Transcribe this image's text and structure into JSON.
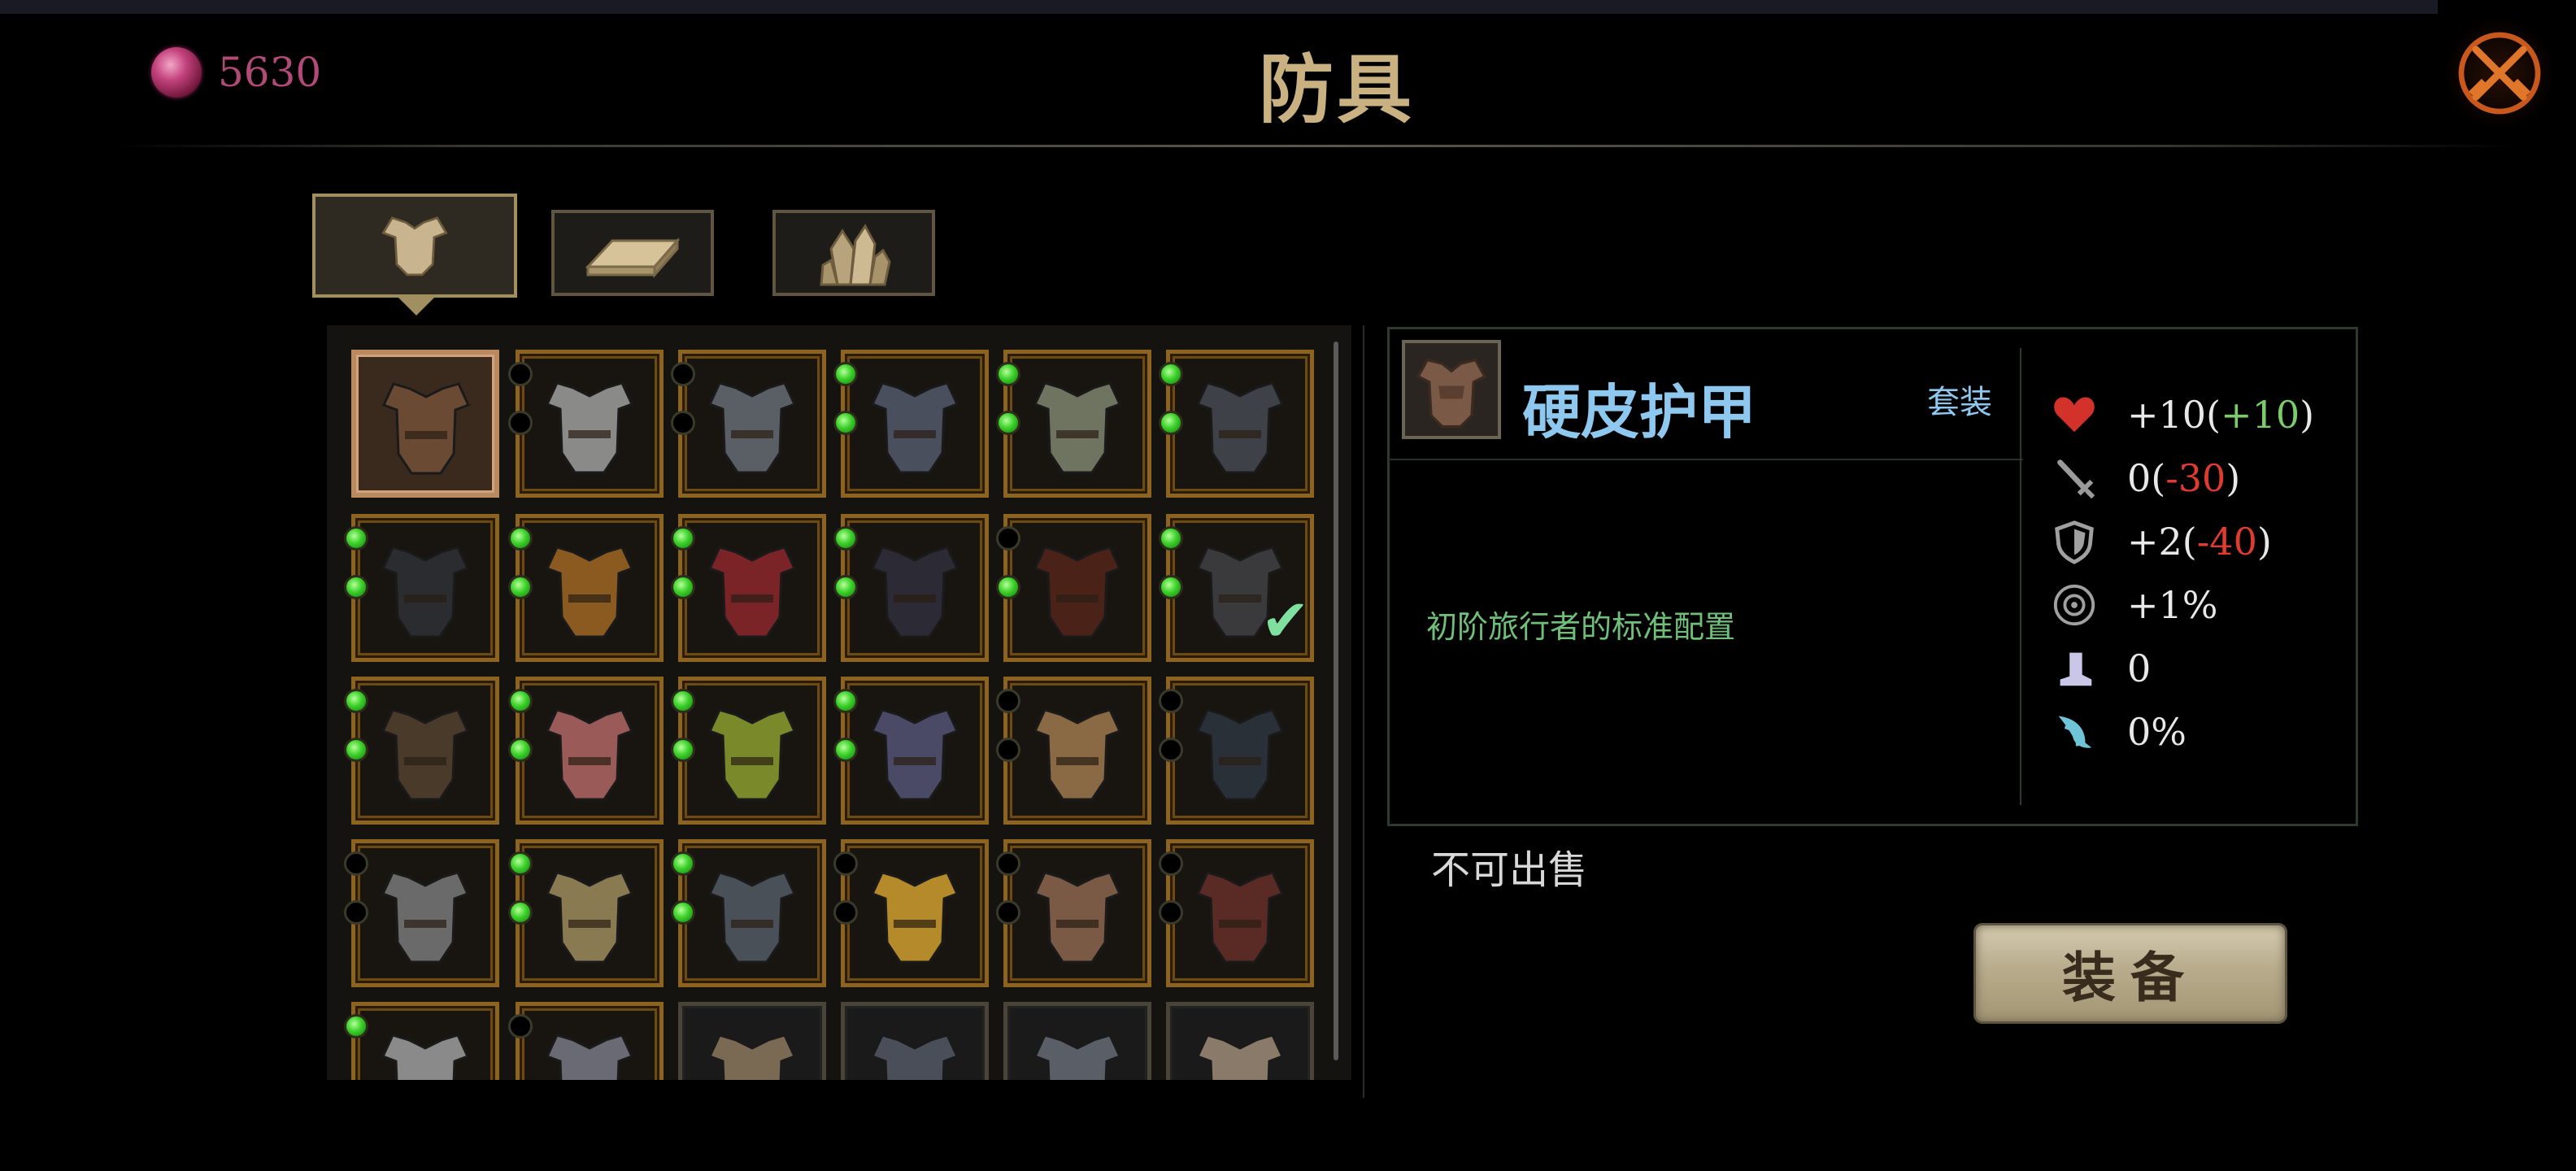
{
  "header": {
    "currency_value": "5630",
    "title": "防具"
  },
  "tabs": [
    {
      "name": "armor",
      "icon": "armor-icon",
      "active": true
    },
    {
      "name": "ingot",
      "icon": "gold-bar-icon",
      "active": false
    },
    {
      "name": "crystal",
      "icon": "crystal-icon",
      "active": false
    }
  ],
  "grid": {
    "rows": [
      [
        {
          "color": "#6b4a34",
          "slots": [],
          "selected": true
        },
        {
          "color": "#8a8a88",
          "slots": [
            false,
            false
          ]
        },
        {
          "color": "#5a5f66",
          "slots": [
            false,
            false
          ]
        },
        {
          "color": "#4a4f5e",
          "slots": [
            true,
            true
          ]
        },
        {
          "color": "#6f7460",
          "slots": [
            true,
            true
          ]
        },
        {
          "color": "#3e4148",
          "slots": [
            true,
            true
          ]
        }
      ],
      [
        {
          "color": "#2a2c30",
          "slots": [
            true,
            true
          ]
        },
        {
          "color": "#8a5a20",
          "slots": [
            true,
            true
          ]
        },
        {
          "color": "#7a2428",
          "slots": [
            true,
            true
          ]
        },
        {
          "color": "#2c2a34",
          "slots": [
            true,
            true
          ]
        },
        {
          "color": "#4a2218",
          "slots": [
            false,
            true
          ]
        },
        {
          "color": "#3a3a3c",
          "slots": [
            true,
            true
          ],
          "equipped": true
        }
      ],
      [
        {
          "color": "#4a3a2a",
          "slots": [
            true,
            true
          ]
        },
        {
          "color": "#9a5a58",
          "slots": [
            true,
            true
          ]
        },
        {
          "color": "#7a8a2a",
          "slots": [
            true,
            true
          ]
        },
        {
          "color": "#4a4a66",
          "slots": [
            true,
            true
          ]
        },
        {
          "color": "#8a6a44",
          "slots": [
            false,
            false
          ]
        },
        {
          "color": "#2a3038",
          "slots": [
            false,
            false
          ]
        }
      ],
      [
        {
          "color": "#6a6a6a",
          "slots": [
            false,
            false
          ]
        },
        {
          "color": "#8a7a52",
          "slots": [
            true,
            true
          ]
        },
        {
          "color": "#4a5058",
          "slots": [
            true,
            true
          ]
        },
        {
          "color": "#b48a2a",
          "slots": [
            false,
            false
          ]
        },
        {
          "color": "#7a5a44",
          "slots": [
            false,
            false
          ]
        },
        {
          "color": "#5a2a24",
          "slots": [
            false,
            false
          ]
        }
      ],
      [
        {
          "color": "#8a8a8a",
          "slots": [
            true
          ]
        },
        {
          "color": "#6a6a74",
          "slots": [
            false
          ]
        },
        {
          "color": "#7a6a54",
          "slots": [],
          "plain": true
        },
        {
          "color": "#4a4e58",
          "slots": [],
          "plain": true
        },
        {
          "color": "#5a5e66",
          "slots": [],
          "plain": true
        },
        {
          "color": "#8a7a6a",
          "slots": [],
          "plain": true
        }
      ]
    ]
  },
  "item": {
    "name": "硬皮护甲",
    "set_label": "套装",
    "description": "初阶旅行者的标准配置",
    "sell_note": "不可出售",
    "equip_label": "装备",
    "stats": [
      {
        "icon": "heart-icon",
        "base": "+10(",
        "delta": "+10",
        "delta_type": "pos",
        "tail": ")"
      },
      {
        "icon": "sword-icon",
        "base": "0(",
        "delta": "-30",
        "delta_type": "neg",
        "tail": ")"
      },
      {
        "icon": "shield-icon",
        "base": "+2(",
        "delta": "-40",
        "delta_type": "neg",
        "tail": ")"
      },
      {
        "icon": "target-icon",
        "base": "+1%",
        "delta": "",
        "delta_type": "",
        "tail": ""
      },
      {
        "icon": "boot-icon",
        "base": "0",
        "delta": "",
        "delta_type": "",
        "tail": ""
      },
      {
        "icon": "claw-icon",
        "base": "0%",
        "delta": "",
        "delta_type": "",
        "tail": ""
      }
    ]
  }
}
